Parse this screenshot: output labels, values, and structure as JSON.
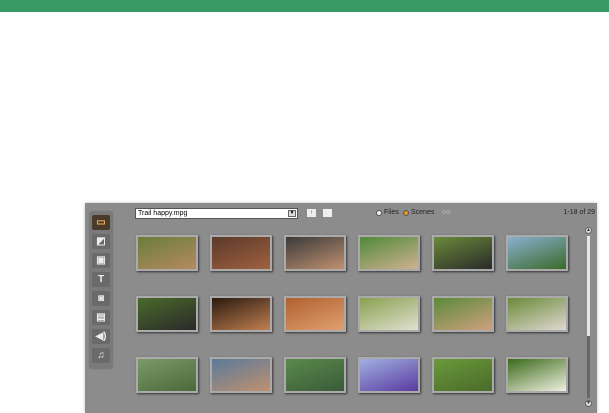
{
  "window": {
    "accent": "#3a9a66"
  },
  "sidebar": {
    "items": [
      {
        "icon": "video-icon",
        "glyph": "▭"
      },
      {
        "icon": "transition-icon",
        "glyph": "◩"
      },
      {
        "icon": "overlay-icon",
        "glyph": "▣"
      },
      {
        "icon": "title-icon",
        "glyph": "T"
      },
      {
        "icon": "photo-icon",
        "glyph": "◙"
      },
      {
        "icon": "disc-menu-icon",
        "glyph": "▤"
      },
      {
        "icon": "sound-icon",
        "glyph": "◀)"
      },
      {
        "icon": "music-icon",
        "glyph": "♫"
      }
    ]
  },
  "toolbar": {
    "file": "Trail happy.mpg",
    "files_label": "Files",
    "scenes_label": "Scenes",
    "count": "1-18 of 29"
  },
  "thumbnails": [
    [
      "#6a7d3a",
      "#b58a60"
    ],
    [
      "#5a3a2a",
      "#a06040"
    ],
    [
      "#3a3a3a",
      "#c09070"
    ],
    [
      "#4f8a3a",
      "#d0b090"
    ],
    [
      "#6a8a3a",
      "#2a2a2a"
    ],
    [
      "#8ab0d0",
      "#3a6a2a"
    ],
    [
      "#4a6a2a",
      "#2a2a2a"
    ],
    [
      "#2a1a10",
      "#c08050"
    ],
    [
      "#b06030",
      "#e0a070"
    ],
    [
      "#8aa050",
      "#e0e0d0"
    ],
    [
      "#5a8a3a",
      "#d0a080"
    ],
    [
      "#6a8a3a",
      "#e0d8d0"
    ],
    [
      "#7a9a6a",
      "#4a6a3a"
    ],
    [
      "#5a7a9a",
      "#c09070"
    ],
    [
      "#5a8a4a",
      "#3a5a3a"
    ],
    [
      "#a0b0e0",
      "#5a3aa0"
    ],
    [
      "#6a9a3a",
      "#4a6a2a"
    ],
    [
      "#3a6a1a",
      "#f0f0e0"
    ]
  ]
}
